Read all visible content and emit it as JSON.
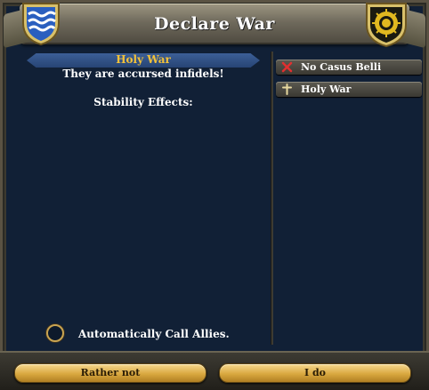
{
  "window": {
    "title": "Declare War"
  },
  "casus_belli": {
    "name": "Holy War",
    "description": "They are accursed infidels!",
    "stability_label": "Stability Effects:"
  },
  "cb_list": [
    {
      "label": "No Casus Belli",
      "icon": "red-x-icon"
    },
    {
      "label": "Holy War",
      "icon": "cross-icon"
    }
  ],
  "call_allies": {
    "label": "Automatically Call Allies.",
    "checked": false
  },
  "buttons": {
    "cancel_label": "Rather not",
    "confirm_label": "I do"
  },
  "colors": {
    "panel": "#112036",
    "title_text": "#ffffff",
    "cb_name": "#f2c13a",
    "button_gold": "#d9a83f"
  }
}
